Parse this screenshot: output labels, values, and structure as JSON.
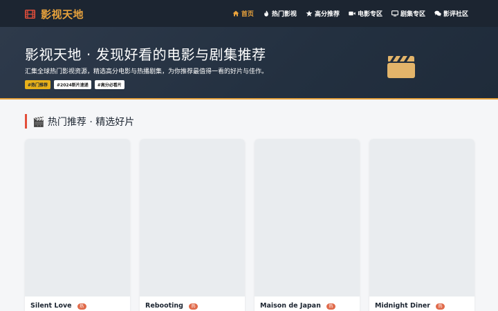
{
  "nav": {
    "brand": "影视天地",
    "items": [
      {
        "label": "首页",
        "icon": "home-icon",
        "active": true
      },
      {
        "label": "热门影视",
        "icon": "fire-icon",
        "active": false
      },
      {
        "label": "高分推荐",
        "icon": "star-icon",
        "active": false
      },
      {
        "label": "电影专区",
        "icon": "video-camera-icon",
        "active": false
      },
      {
        "label": "剧集专区",
        "icon": "tv-icon",
        "active": false
      },
      {
        "label": "影评社区",
        "icon": "comments-icon",
        "active": false
      }
    ]
  },
  "hero": {
    "title": "影视天地 · 发现好看的电影与剧集推荐",
    "subtitle": "汇集全球热门影视资源，精选高分电影与热播剧集，为你推荐最值得一看的好片与佳作。",
    "tags": [
      "#热门推荐",
      "#2024新片速递",
      "#高分必看片"
    ],
    "icon": "clapperboard-icon"
  },
  "section": {
    "title": "🎬 热门推荐 · 精选好片"
  },
  "cards": [
    {
      "title": "Silent Love",
      "badge": "热"
    },
    {
      "title": "Rebooting",
      "badge": "热"
    },
    {
      "title": "Maison de Japan",
      "badge": "热"
    },
    {
      "title": "Midnight Diner",
      "badge": "热"
    }
  ],
  "colors": {
    "nav_bg": "#1c2531",
    "accent": "#e8a23c",
    "section_bar": "#e34e3a",
    "badge": "#e06a4a"
  }
}
